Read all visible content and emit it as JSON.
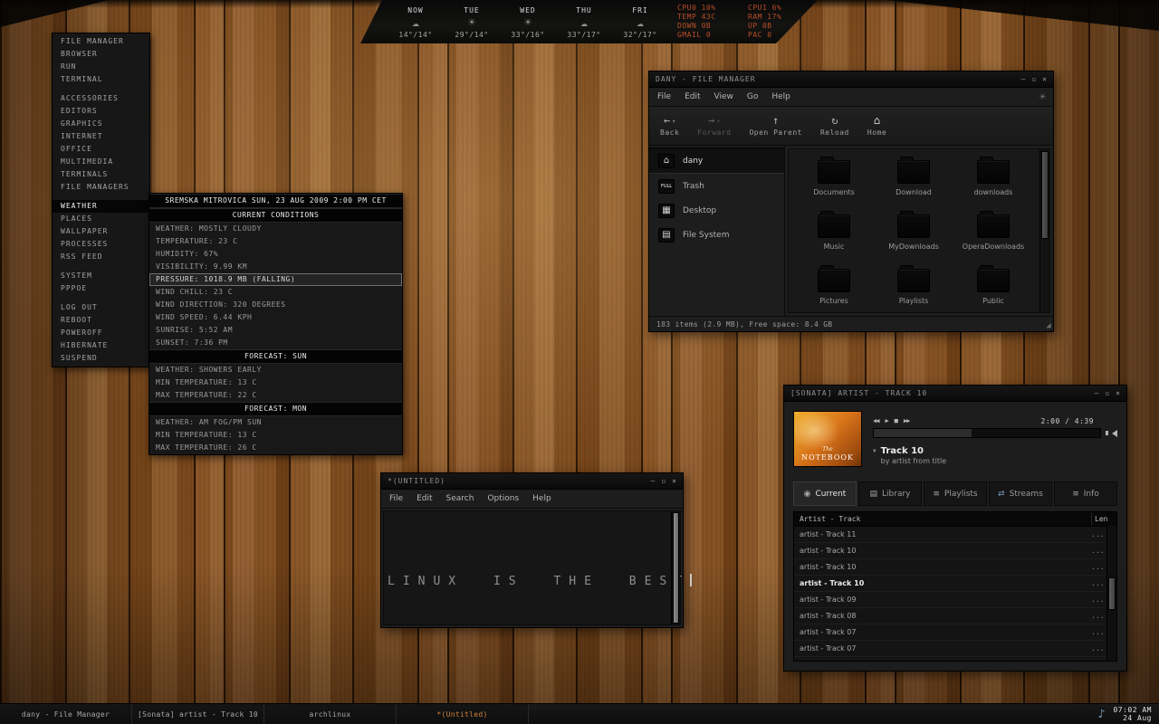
{
  "colors": {
    "stat_text": "#b84e28",
    "active_task_text": "#d2813a",
    "wood_base": "#8a5526",
    "window_bg": "#1d1d1d"
  },
  "icons": {
    "caret": "▾",
    "minimize": "–",
    "maximize": "▫",
    "close": "×",
    "logo": "☀",
    "grip": "◢",
    "note": "♪",
    "expander": "▼"
  },
  "top_panel": {
    "forecast": [
      {
        "day": "NOW",
        "icon": "cloudy-night-icon",
        "glyph": "☁",
        "temp": "14°/14°"
      },
      {
        "day": "TUE",
        "icon": "sunny-icon",
        "glyph": "☀",
        "temp": "29°/14°"
      },
      {
        "day": "WED",
        "icon": "sunny-icon",
        "glyph": "☀",
        "temp": "33°/16°"
      },
      {
        "day": "THU",
        "icon": "cloudy-icon",
        "glyph": "☁",
        "temp": "33°/17°"
      },
      {
        "day": "FRI",
        "icon": "partly-cloudy-icon",
        "glyph": "☁",
        "temp": "32°/17°"
      }
    ],
    "stats": [
      {
        "left": "CPU0 10%",
        "right": "CPU1 6%"
      },
      {
        "left": "TEMP 43C",
        "right": "RAM 17%"
      },
      {
        "left": "DOWN 0B",
        "right": "UP 0B"
      },
      {
        "left": "GMAIL 0",
        "right": "PAC 0"
      }
    ]
  },
  "root_menu": {
    "items": [
      {
        "label": "FILE MANAGER"
      },
      {
        "label": "BROWSER"
      },
      {
        "label": "RUN"
      },
      {
        "label": "TERMINAL"
      },
      {
        "sep": true
      },
      {
        "label": "ACCESSORIES"
      },
      {
        "label": "EDITORS"
      },
      {
        "label": "GRAPHICS"
      },
      {
        "label": "INTERNET"
      },
      {
        "label": "OFFICE"
      },
      {
        "label": "MULTIMEDIA"
      },
      {
        "label": "TERMINALS"
      },
      {
        "label": "FILE MANAGERS"
      },
      {
        "sep": true
      },
      {
        "label": "WEATHER",
        "selected": true
      },
      {
        "label": "PLACES"
      },
      {
        "label": "WALLPAPER"
      },
      {
        "label": "PROCESSES"
      },
      {
        "label": "RSS FEED"
      },
      {
        "sep": true
      },
      {
        "label": "SYSTEM"
      },
      {
        "label": "PPPOE"
      },
      {
        "sep": true
      },
      {
        "label": "LOG OUT"
      },
      {
        "label": "REBOOT"
      },
      {
        "label": "POWEROFF"
      },
      {
        "label": "HIBERNATE"
      },
      {
        "label": "SUSPEND"
      }
    ]
  },
  "weather_menu": {
    "title": "SREMSKA MITROVICA SUN, 23 AUG 2009 2:00 PM CET",
    "current_header": "CURRENT CONDITIONS",
    "current_rows": [
      {
        "label": "WEATHER: MOSTLY CLOUDY"
      },
      {
        "label": "TEMPERATURE: 23 C"
      },
      {
        "label": "HUMIDITY: 67%"
      },
      {
        "label": "VISIBILITY: 9.99 KM"
      },
      {
        "label": "PRESSURE: 1018.9 MB (FALLING)",
        "hl": true
      },
      {
        "label": "WIND CHILL: 23 C"
      },
      {
        "label": "WIND DIRECTION: 320 DEGREES"
      },
      {
        "label": "WIND SPEED: 6.44 KPH"
      },
      {
        "label": "SUNRISE: 5:52 AM"
      },
      {
        "label": "SUNSET: 7:36 PM"
      }
    ],
    "sun_header": "FORECAST: SUN",
    "sun_rows": [
      {
        "label": "WEATHER: SHOWERS EARLY"
      },
      {
        "label": "MIN TEMPERATURE: 13 C"
      },
      {
        "label": "MAX TEMPERATURE: 22 C"
      }
    ],
    "mon_header": "FORECAST: MON",
    "mon_rows": [
      {
        "label": "WEATHER: AM FOG/PM SUN"
      },
      {
        "label": "MIN TEMPERATURE: 13 C"
      },
      {
        "label": "MAX TEMPERATURE: 26 C"
      }
    ]
  },
  "file_manager": {
    "title": "DANY - FILE MANAGER",
    "menu": [
      "File",
      "Edit",
      "View",
      "Go",
      "Help"
    ],
    "toolbar": [
      {
        "label": "Back",
        "glyph": "←",
        "dropdown": true
      },
      {
        "label": "Forward",
        "glyph": "→",
        "dropdown": true,
        "dim": true
      },
      {
        "label": "Open Parent",
        "glyph": "↑"
      },
      {
        "label": "Reload",
        "glyph": "↻"
      },
      {
        "label": "Home",
        "glyph": "⌂",
        "bright": true
      }
    ],
    "places": [
      {
        "label": "dany",
        "glyph": "⌂",
        "selected": true
      },
      {
        "label": "Trash",
        "glyph": "FULL",
        "full": true
      },
      {
        "label": "Desktop",
        "glyph": "▦"
      },
      {
        "label": "File System",
        "glyph": "▤"
      }
    ],
    "folders": [
      {
        "name": "Documents"
      },
      {
        "name": "Download"
      },
      {
        "name": "downloads"
      },
      {
        "name": "Music"
      },
      {
        "name": "MyDownloads"
      },
      {
        "name": "OperaDownloads"
      },
      {
        "name": "Pictures"
      },
      {
        "name": "Playlists"
      },
      {
        "name": "Public"
      }
    ],
    "status": "183 items (2.9 MB), Free space: 8.4 GB"
  },
  "editor": {
    "title": "*(UNTITLED)",
    "menu": [
      "File",
      "Edit",
      "Search",
      "Options",
      "Help"
    ],
    "text": "LINUX IS THE BEST"
  },
  "player": {
    "title": "[SONATA] ARTIST - TRACK 10",
    "art_line1": "The",
    "art_line2": "NOTEBOOK",
    "controls": {
      "prev": "◀◀",
      "play": "▶",
      "stop": "■",
      "next": "▶▶"
    },
    "time": "2:00 / 4:39",
    "progress_style": "width:43%",
    "track": "Track 10",
    "track_sub": "by artist from title",
    "tabs": [
      {
        "label": "Current",
        "glyph": "◉",
        "selected": true
      },
      {
        "label": "Library",
        "glyph": "▤"
      },
      {
        "label": "Playlists",
        "glyph": "≡"
      },
      {
        "label": "Streams",
        "glyph": "⇄",
        "blue": true
      },
      {
        "label": "Info",
        "glyph": "≡"
      }
    ],
    "header_track": "Artist - Track",
    "header_len": "Len",
    "rows": [
      {
        "title": "artist - Track 11",
        "len": "..."
      },
      {
        "title": "artist - Track 10",
        "len": "..."
      },
      {
        "title": "artist - Track 10",
        "len": "..."
      },
      {
        "title": "artist - Track 10",
        "len": "...",
        "current": true
      },
      {
        "title": "artist - Track 09",
        "len": "..."
      },
      {
        "title": "artist - Track 08",
        "len": "..."
      },
      {
        "title": "artist - Track 07",
        "len": "..."
      },
      {
        "title": "artist - Track 07",
        "len": "..."
      }
    ]
  },
  "taskbar": {
    "tasks": [
      {
        "label": "dany - File Manager"
      },
      {
        "label": "[Sonata] artist - Track 10"
      },
      {
        "label": "archlinux"
      },
      {
        "label": "*(Untitled)",
        "active": true
      }
    ],
    "time": "07:02 AM",
    "date": "24 Aug"
  }
}
